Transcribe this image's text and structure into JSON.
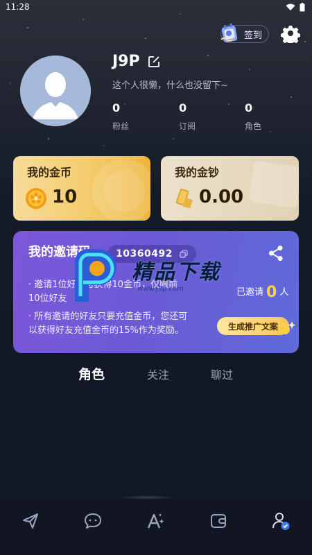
{
  "status_bar": {
    "time": "11:28"
  },
  "header": {
    "checkin_label": "签到"
  },
  "profile": {
    "username": "J9P",
    "bio": "这个人很懒，什么也没留下~",
    "stats": [
      {
        "value": "0",
        "label": "粉丝"
      },
      {
        "value": "0",
        "label": "订阅"
      },
      {
        "value": "0",
        "label": "角色"
      }
    ]
  },
  "wallet": {
    "coins": {
      "title": "我的金币",
      "value": "10"
    },
    "cash": {
      "title": "我的金钞",
      "value": "0.00"
    }
  },
  "invite": {
    "title": "我的邀请码",
    "code": "10360492",
    "rule1_line1": "· 邀请1位好友可获得10金币，仅限前",
    "rule1_line2": "10位好友",
    "rule2_line1": "· 所有邀请的好友只要充值金币，您还可",
    "rule2_line2": "以获得好友充值金币的15%作为奖励。",
    "invited_prefix": "已邀请",
    "invited_count": "0",
    "invited_suffix": "人",
    "generate_label": "生成推广文案"
  },
  "watermark": {
    "text": "精品下载",
    "url": "www.j3p.com"
  },
  "tabs": [
    {
      "label": "角色",
      "active": true
    },
    {
      "label": "关注",
      "active": false
    },
    {
      "label": "聊过",
      "active": false
    }
  ],
  "bottom_nav": [
    {
      "icon": "send-icon"
    },
    {
      "icon": "chat-icon"
    },
    {
      "icon": "create-ai-icon"
    },
    {
      "icon": "wallet-icon"
    },
    {
      "icon": "profile-icon",
      "active": true
    }
  ],
  "colors": {
    "accent": "#6c5ad6",
    "gold": "#f4cc6c",
    "highlight": "#ffd14a"
  }
}
